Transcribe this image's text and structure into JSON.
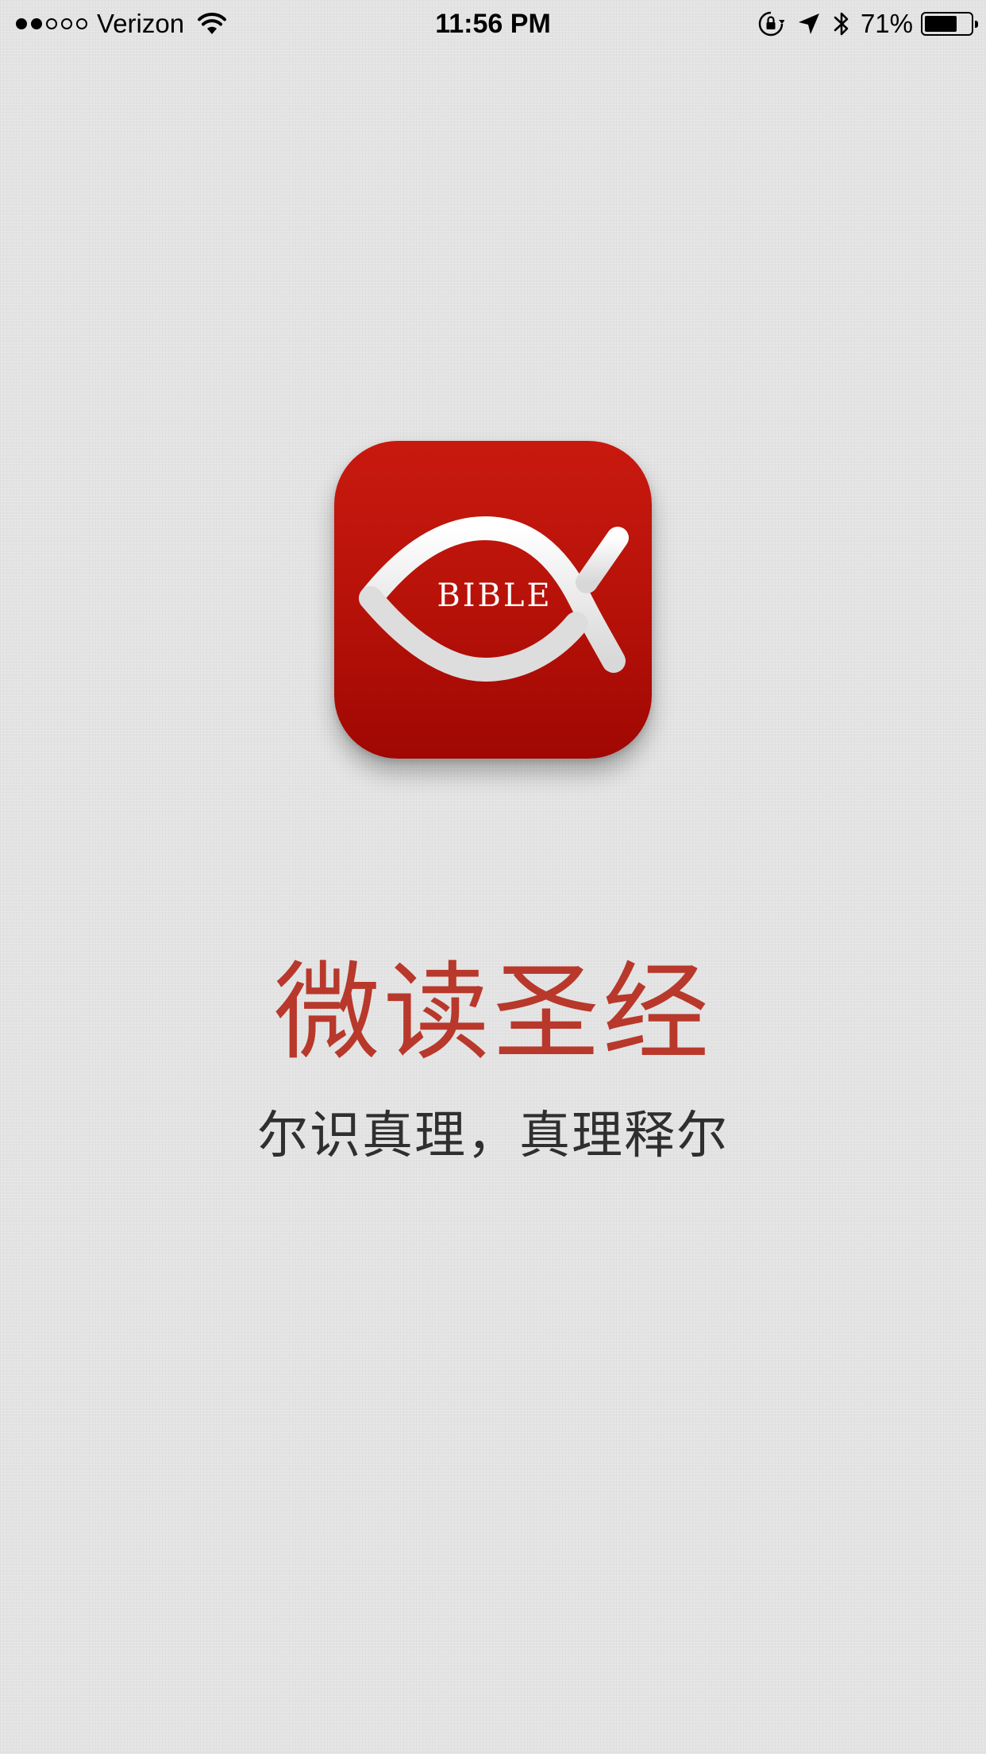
{
  "status_bar": {
    "signal_dots": [
      true,
      true,
      false,
      false,
      false
    ],
    "carrier": "Verizon",
    "time": "11:56 PM",
    "battery_percent": "71%",
    "battery_level": 0.71,
    "icons": [
      "wifi-icon",
      "orientation-lock-icon",
      "location-arrow-icon",
      "bluetooth-icon",
      "battery-icon"
    ]
  },
  "splash": {
    "logo_text": "BIBLE",
    "title": "微读圣经",
    "slogan": "尔识真理，真理释尔"
  },
  "colors": {
    "background": "#e3e3e3",
    "icon_red_top": "#c9190f",
    "icon_red_bottom": "#a00703",
    "title_red": "#b8382b",
    "slogan_gray": "#2f2f2f"
  }
}
